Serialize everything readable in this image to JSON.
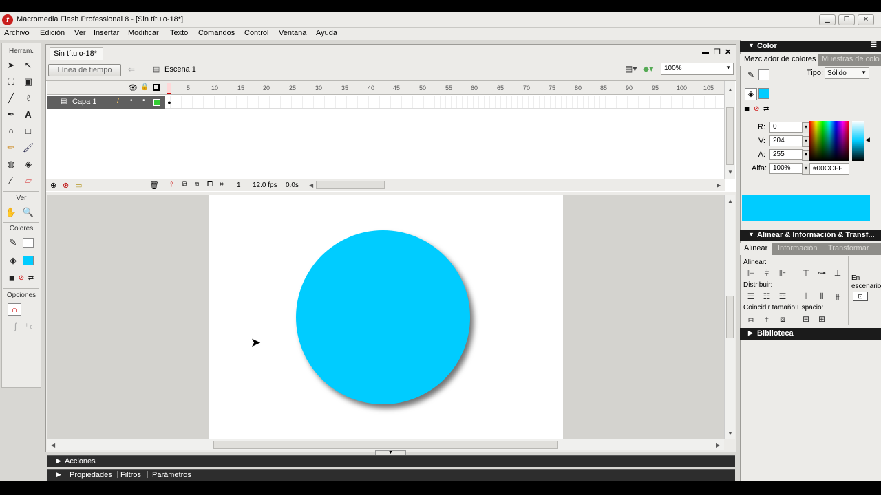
{
  "app": {
    "title": "Macromedia Flash Professional 8 - [Sin título-18*]",
    "icon_letter": "f"
  },
  "menu": [
    "Archivo",
    "Edición",
    "Ver",
    "Insertar",
    "Modificar",
    "Texto",
    "Comandos",
    "Control",
    "Ventana",
    "Ayuda"
  ],
  "tools": {
    "header": "Herram.",
    "view_label": "Ver",
    "colors_label": "Colores",
    "options_label": "Opciones",
    "text_tool_glyph": "A",
    "fill_color": "#00ccff",
    "stroke_color": "#ffffff"
  },
  "document": {
    "tab_title": "Sin título-18*",
    "timeline_button": "Línea de tiempo",
    "scene": "Escena 1",
    "zoom": "100%"
  },
  "timeline": {
    "layer_name": "Capa 1",
    "ruler_labels": [
      "1",
      "5",
      "10",
      "15",
      "20",
      "25",
      "30",
      "35",
      "40",
      "45",
      "50",
      "55",
      "60",
      "65",
      "70",
      "75",
      "80",
      "85",
      "90",
      "95",
      "100",
      "105"
    ],
    "current_frame": "1",
    "fps": "12.0 fps",
    "time": "0.0s"
  },
  "stage": {
    "shape_color": "#00ccff",
    "shape": "circle"
  },
  "bottom_panels": {
    "actions": "Acciones",
    "properties": "Propiedades",
    "filters": "Filtros",
    "parameters": "Parámetros"
  },
  "color_panel": {
    "title": "Color",
    "tab_mixer": "Mezclador de colores",
    "tab_swatches": "Muestras de colo",
    "type_label": "Tipo:",
    "type_value": "Sólido",
    "r_label": "R:",
    "r_value": "0",
    "g_label": "V:",
    "g_value": "204",
    "b_label": "A:",
    "b_value": "255",
    "alpha_label": "Alfa:",
    "alpha_value": "100%",
    "hex_value": "#00CCFF",
    "preview_color": "#00ccff"
  },
  "align_panel": {
    "title": "Alinear & Información & Transf...",
    "tab_align": "Alinear",
    "tab_info": "Información",
    "tab_transform": "Transformar",
    "align_label": "Alinear:",
    "distribute_label": "Distribuir:",
    "match_size_label": "Coincidir tamaño:",
    "spacing_label": "Espacio:",
    "to_stage_label_1": "En",
    "to_stage_label_2": "escenario"
  },
  "library_panel": {
    "title": "Biblioteca"
  }
}
